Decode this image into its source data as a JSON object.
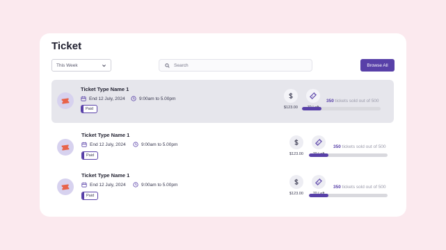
{
  "header": {
    "title": "Ticket"
  },
  "filter": {
    "selected": "This Week"
  },
  "search": {
    "placeholder": "Search"
  },
  "toolbar": {
    "browse_label": "Browse All"
  },
  "colors": {
    "accent": "#5840a8",
    "ticket_icon": "#e8634a",
    "avatar_bg": "#d7d2ef",
    "highlight_row": "#e6e6ec"
  },
  "icons": {
    "ticket": "ticket-icon",
    "calendar": "calendar-icon",
    "clock": "clock-icon",
    "dollar": "dollar-icon",
    "ticket_stub": "ticket-stub-icon",
    "search": "search-icon",
    "chevron": "chevron-down-icon"
  },
  "rows": [
    {
      "name": "Ticket Type Name 1",
      "end_date": "End 12 July, 2024",
      "time": "9:00am to 5.00pm",
      "status": "Paid",
      "price": "$123.00",
      "left": "70 Left",
      "sold": "350",
      "sold_suffix": "tickets sold out of 500",
      "progress": 0.25
    },
    {
      "name": "Ticket Type Name 1",
      "end_date": "End 12 July, 2024",
      "time": "9:00am to 5.00pm",
      "status": "Paid",
      "price": "$123.00",
      "left": "70 Left",
      "sold": "350",
      "sold_suffix": "tickets sold out of 500",
      "progress": 0.25
    },
    {
      "name": "Ticket Type Name 1",
      "end_date": "End 12 July, 2024",
      "time": "9:00am to 5.00pm",
      "status": "Paid",
      "price": "$123.00",
      "left": "70 Left",
      "sold": "350",
      "sold_suffix": "tickets sold out of 500",
      "progress": 0.25
    }
  ]
}
